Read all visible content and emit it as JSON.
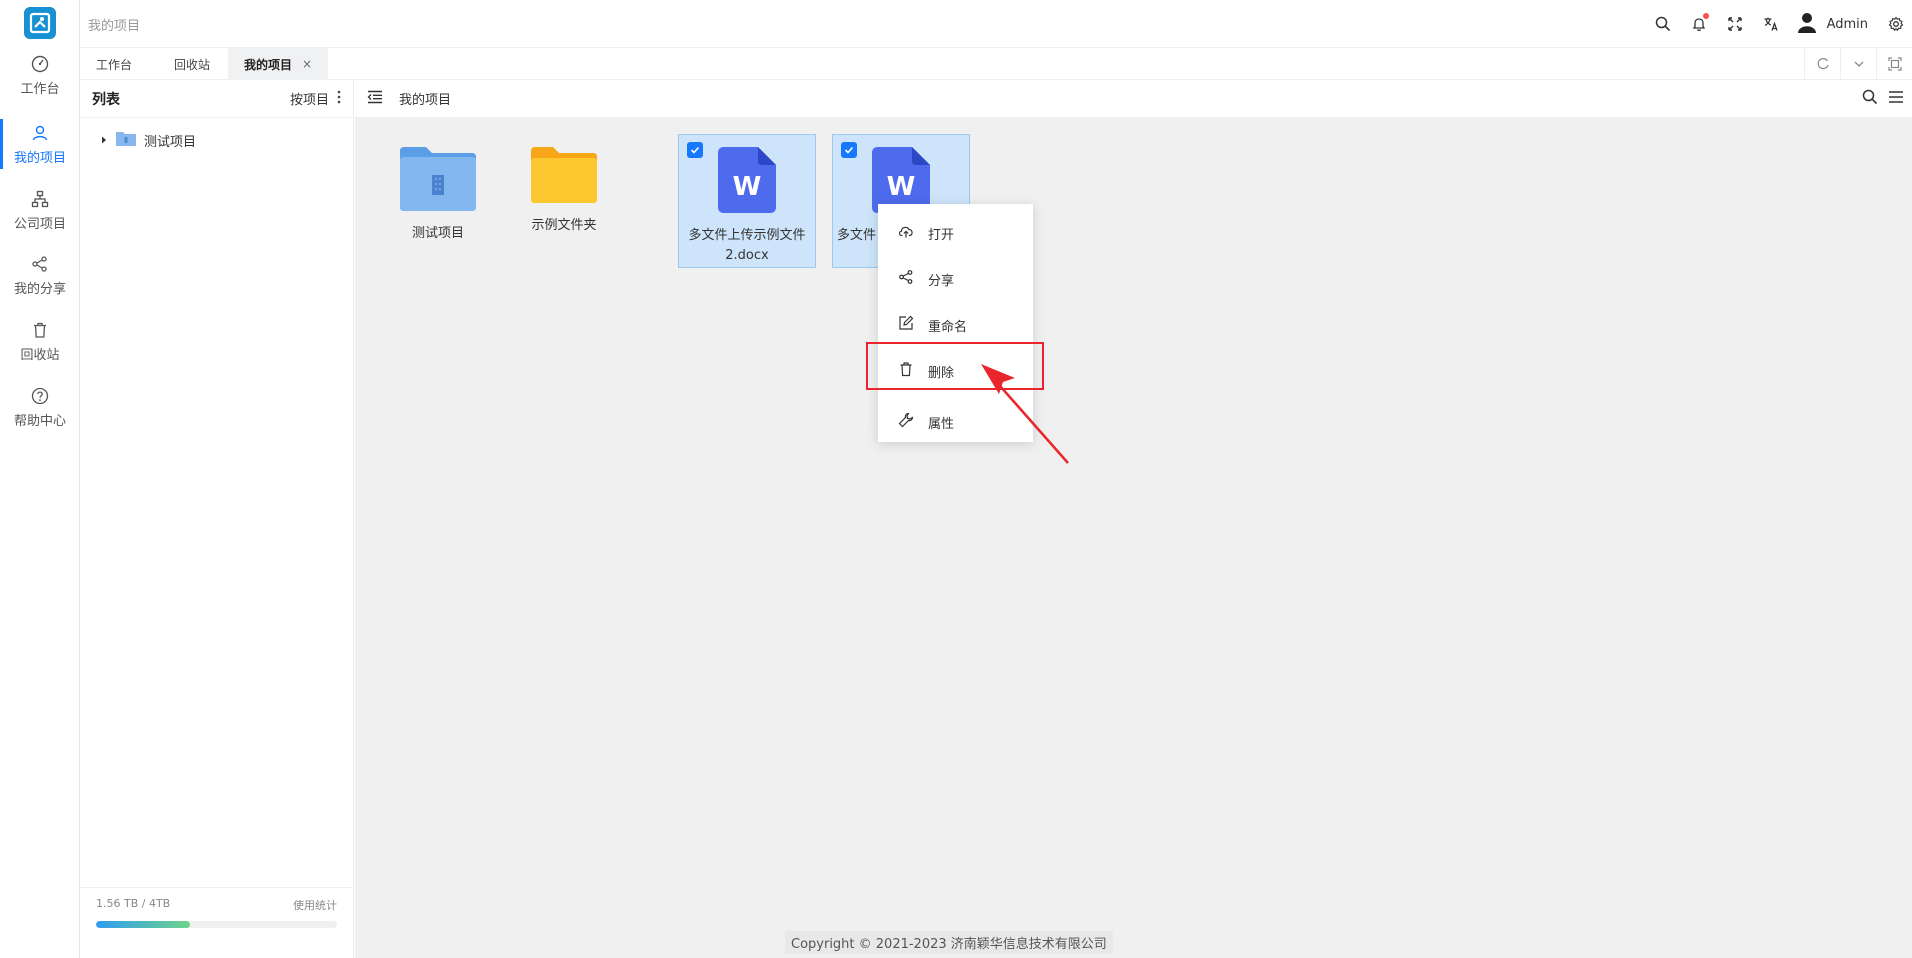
{
  "header": {
    "breadcrumb": "我的项目",
    "user_name": "Admin",
    "icons": [
      "search-icon",
      "bell-icon",
      "fullscreen-icon",
      "translate-icon",
      "user-avatar-icon",
      "settings-icon"
    ]
  },
  "rail": {
    "items": [
      {
        "label": "工作台",
        "icon": "dashboard-icon"
      },
      {
        "label": "我的项目",
        "icon": "user-icon",
        "active": true
      },
      {
        "label": "公司项目",
        "icon": "org-chart-icon"
      },
      {
        "label": "我的分享",
        "icon": "share-icon"
      },
      {
        "label": "回收站",
        "icon": "trash-icon"
      },
      {
        "label": "帮助中心",
        "icon": "help-icon"
      }
    ]
  },
  "tabs": [
    {
      "label": "工作台"
    },
    {
      "label": "回收站"
    },
    {
      "label": "我的项目",
      "active": true,
      "close": "×"
    }
  ],
  "tree": {
    "title": "列表",
    "sort_label": "按项目",
    "nodes": [
      {
        "label": "测试项目"
      }
    ],
    "storage_text": "1.56 TB / 4TB",
    "usage_link": "使用统计",
    "usage_fraction": 0.39
  },
  "main": {
    "title": "我的项目",
    "files": [
      {
        "name": "测试项目",
        "type": "project-folder",
        "selected": false
      },
      {
        "name": "示例文件夹",
        "type": "folder",
        "selected": false
      },
      {
        "name": "多文件上传示例文件2.docx",
        "type": "word",
        "selected": true
      },
      {
        "name": "多文件",
        "type": "word",
        "selected": true
      }
    ],
    "copyright": "Copyright © 2021-2023 济南颖华信息技术有限公司"
  },
  "context_menu": {
    "items": [
      {
        "label": "打开",
        "icon": "cloud-upload-icon"
      },
      {
        "label": "分享",
        "icon": "share-icon"
      },
      {
        "label": "重命名",
        "icon": "edit-icon"
      },
      {
        "label": "删除",
        "icon": "trash-icon",
        "highlighted": true
      },
      {
        "label": "属性",
        "icon": "wrench-icon"
      }
    ]
  },
  "colors": {
    "accent": "#1677ff",
    "highlight": "#e8262c",
    "word": "#4f6bed",
    "folder": "#f8c02c"
  }
}
